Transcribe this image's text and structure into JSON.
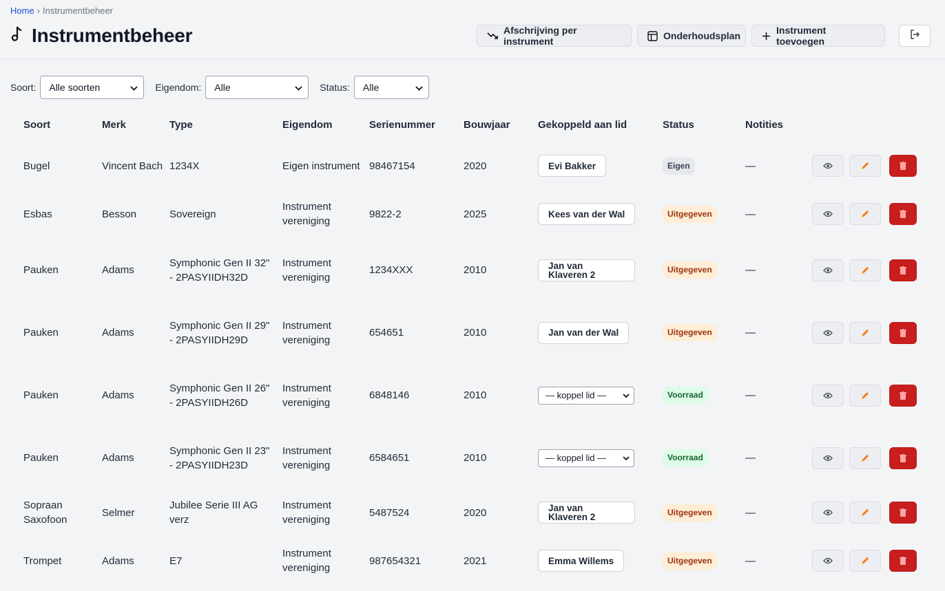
{
  "breadcrumb": {
    "home": "Home",
    "separator": "›",
    "current": "Instrumentbeheer"
  },
  "page": {
    "title": "Instrumentbeheer",
    "title_icon": "music-note-icon"
  },
  "toolbar": {
    "depreciation_label": "Afschrijving per instrument",
    "maintenance_label": "Onderhoudsplan",
    "add_label": "Instrument toevoegen",
    "logout_icon": "logout-icon"
  },
  "filters": {
    "soort_label": "Soort:",
    "soort_value": "Alle soorten",
    "eigendom_label": "Eigendom:",
    "eigendom_value": "Alle",
    "status_label": "Status:",
    "status_value": "Alle"
  },
  "table": {
    "headers": [
      "Soort",
      "Merk",
      "Type",
      "Eigendom",
      "Serienummer",
      "Bouwjaar",
      "Gekoppeld aan lid",
      "Status",
      "Notities"
    ],
    "rows": [
      {
        "soort": "Bugel",
        "merk": "Vincent Bach",
        "type": "1234X",
        "eigendom": "Eigen instrument",
        "serienummer": "98467154",
        "bouwjaar": "2020",
        "lid": "Evi Bakker",
        "status": "Eigen",
        "status_kind": "eigen",
        "notities": "—"
      },
      {
        "soort": "Esbas",
        "merk": "Besson",
        "type": "Sovereign",
        "eigendom": "Instrument vereniging",
        "serienummer": "9822-2",
        "bouwjaar": "2025",
        "lid": "Kees van der Wal",
        "status": "Uitgegeven",
        "status_kind": "uit",
        "notities": "—"
      },
      {
        "soort": "Pauken",
        "merk": "Adams",
        "type": "Symphonic Gen II 32\" - 2PASYIIDH32D",
        "eigendom": "Instrument vereniging",
        "serienummer": "1234XXX",
        "bouwjaar": "2010",
        "lid": "Jan van Klaveren 2",
        "status": "Uitgegeven",
        "status_kind": "uit",
        "notities": "—"
      },
      {
        "soort": "Pauken",
        "merk": "Adams",
        "type": "Symphonic Gen II 29\" - 2PASYIIDH29D",
        "eigendom": "Instrument vereniging",
        "serienummer": "654651",
        "bouwjaar": "2010",
        "lid": "Jan van der Wal",
        "status": "Uitgegeven",
        "status_kind": "uit",
        "notities": "—"
      },
      {
        "soort": "Pauken",
        "merk": "Adams",
        "type": "Symphonic Gen II 26\" - 2PASYIIDH26D",
        "eigendom": "Instrument vereniging",
        "serienummer": "6848146",
        "bouwjaar": "2010",
        "lid": "— koppel lid —",
        "status": "Voorraad",
        "status_kind": "voor",
        "notities": "—"
      },
      {
        "soort": "Pauken",
        "merk": "Adams",
        "type": "Symphonic Gen II 23\" - 2PASYIIDH23D",
        "eigendom": "Instrument vereniging",
        "serienummer": "6584651",
        "bouwjaar": "2010",
        "lid": "— koppel lid —",
        "status": "Voorraad",
        "status_kind": "voor",
        "notities": "—"
      },
      {
        "soort": "Sopraan Saxofoon",
        "merk": "Selmer",
        "type": "Jubilee Serie III AG verz",
        "eigendom": "Instrument vereniging",
        "serienummer": "5487524",
        "bouwjaar": "2020",
        "lid": "Jan van Klaveren 2",
        "status": "Uitgegeven",
        "status_kind": "uit",
        "notities": "—"
      },
      {
        "soort": "Trompet",
        "merk": "Adams",
        "type": "E7",
        "eigendom": "Instrument vereniging",
        "serienummer": "987654321",
        "bouwjaar": "2021",
        "lid": "Emma Willems",
        "status": "Uitgegeven",
        "status_kind": "uit",
        "notities": "—"
      }
    ]
  }
}
